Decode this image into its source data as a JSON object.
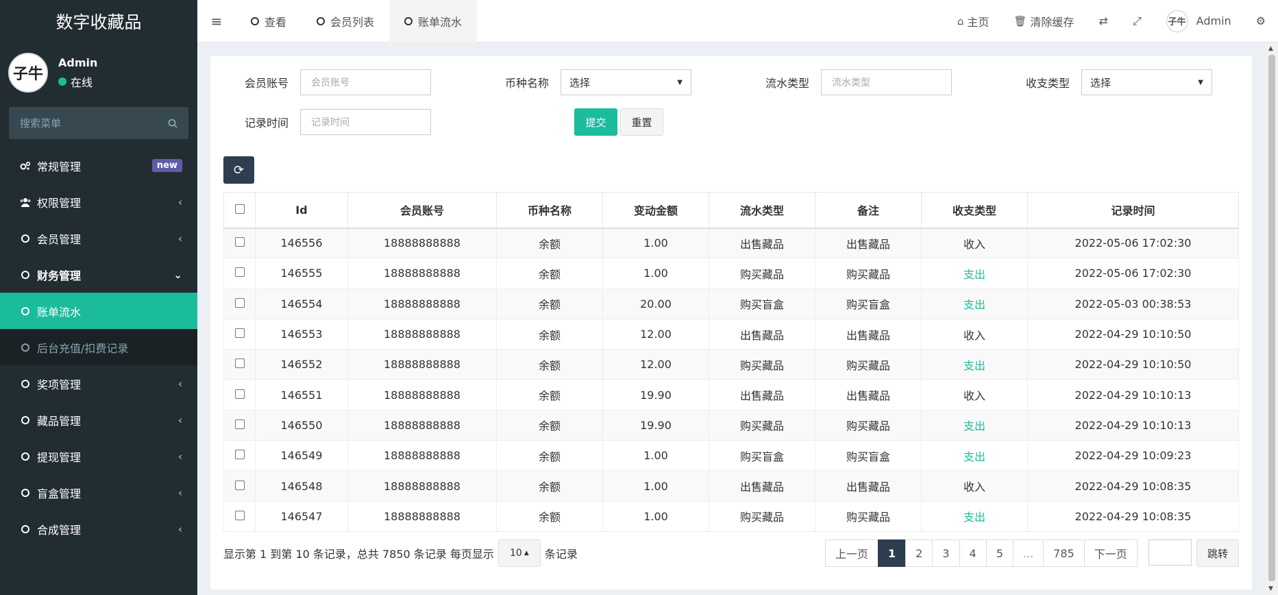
{
  "sidebar": {
    "brand": "数字收藏品",
    "user": {
      "name": "Admin",
      "status": "在线",
      "avatar_text": "子牛"
    },
    "search_placeholder": "搜索菜单",
    "items": [
      {
        "label": "常规管理",
        "icon": "cogs-icon",
        "badge": "new"
      },
      {
        "label": "权限管理",
        "icon": "users-icon"
      },
      {
        "label": "会员管理",
        "icon": "circle-icon"
      },
      {
        "label": "财务管理",
        "icon": "circle-icon"
      },
      {
        "label": "账单流水",
        "icon": "circle-icon"
      },
      {
        "label": "后台充值/扣费记录",
        "icon": "circle-icon"
      },
      {
        "label": "奖项管理",
        "icon": "circle-icon"
      },
      {
        "label": "藏品管理",
        "icon": "circle-icon"
      },
      {
        "label": "提现管理",
        "icon": "circle-icon"
      },
      {
        "label": "盲盒管理",
        "icon": "circle-icon"
      },
      {
        "label": "合成管理",
        "icon": "circle-icon"
      }
    ]
  },
  "header": {
    "tabs": [
      "查看",
      "会员列表",
      "账单流水"
    ],
    "home": "主页",
    "clear_cache": "清除缓存",
    "admin": "Admin"
  },
  "filters": {
    "member_account": {
      "label": "会员账号",
      "placeholder": "会员账号"
    },
    "currency": {
      "label": "币种名称",
      "value": "选择"
    },
    "flow_type": {
      "label": "流水类型",
      "placeholder": "流水类型"
    },
    "io_type": {
      "label": "收支类型",
      "value": "选择"
    },
    "record_time": {
      "label": "记录时间",
      "placeholder": "记录时间"
    },
    "submit": "提交",
    "reset": "重置"
  },
  "table": {
    "headers": [
      "Id",
      "会员账号",
      "币种名称",
      "变动金额",
      "流水类型",
      "备注",
      "收支类型",
      "记录时间"
    ],
    "rows": [
      [
        "146556",
        "18888888888",
        "余额",
        "1.00",
        "出售藏品",
        "出售藏品",
        "收入",
        "2022-05-06 17:02:30"
      ],
      [
        "146555",
        "18888888888",
        "余额",
        "1.00",
        "购买藏品",
        "购买藏品",
        "支出",
        "2022-05-06 17:02:30"
      ],
      [
        "146554",
        "18888888888",
        "余额",
        "20.00",
        "购买盲盒",
        "购买盲盒",
        "支出",
        "2022-05-03 00:38:53"
      ],
      [
        "146553",
        "18888888888",
        "余额",
        "12.00",
        "出售藏品",
        "出售藏品",
        "收入",
        "2022-04-29 10:10:50"
      ],
      [
        "146552",
        "18888888888",
        "余额",
        "12.00",
        "购买藏品",
        "购买藏品",
        "支出",
        "2022-04-29 10:10:50"
      ],
      [
        "146551",
        "18888888888",
        "余额",
        "19.90",
        "出售藏品",
        "出售藏品",
        "收入",
        "2022-04-29 10:10:13"
      ],
      [
        "146550",
        "18888888888",
        "余额",
        "19.90",
        "购买藏品",
        "购买藏品",
        "支出",
        "2022-04-29 10:10:13"
      ],
      [
        "146549",
        "18888888888",
        "余额",
        "1.00",
        "购买盲盒",
        "购买盲盒",
        "支出",
        "2022-04-29 10:09:23"
      ],
      [
        "146548",
        "18888888888",
        "余额",
        "1.00",
        "出售藏品",
        "出售藏品",
        "收入",
        "2022-04-29 10:08:35"
      ],
      [
        "146547",
        "18888888888",
        "余额",
        "1.00",
        "购买藏品",
        "购买藏品",
        "支出",
        "2022-04-29 10:08:35"
      ]
    ]
  },
  "pager": {
    "info": "显示第 1 到第 10 条记录，总共 7850 条记录 每页显示",
    "page_size": "10",
    "suffix": "条记录",
    "prev": "上一页",
    "pages": [
      "1",
      "2",
      "3",
      "4",
      "5",
      "...",
      "785"
    ],
    "next": "下一页",
    "jump": "跳转"
  },
  "colors": {
    "accent": "#1abc9c",
    "sidebar": "#222d32",
    "primary_dark": "#2c3e50",
    "badge": "#605ca8"
  }
}
